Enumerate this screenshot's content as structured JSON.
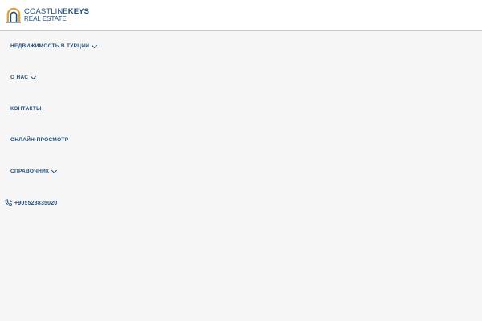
{
  "logo": {
    "word1": "COASTLINE",
    "word2": "KEYS",
    "line2": "REAL ESTATE"
  },
  "menu": {
    "items": [
      {
        "label": "НЕДВИЖИМОСТЬ В ТУРЦИИ",
        "has_dropdown": true
      },
      {
        "label": "О НАС",
        "has_dropdown": true
      },
      {
        "label": "КОНТАКТЫ",
        "has_dropdown": false
      },
      {
        "label": "ОНЛАЙН-ПРОСМОТР",
        "has_dropdown": false
      },
      {
        "label": "СПРАВОЧНИК",
        "has_dropdown": true
      }
    ]
  },
  "phone": {
    "number": "+905528835020",
    "icon": "phone-icon"
  },
  "colors": {
    "brand": "#1f4e79",
    "accent": "#d9a441",
    "background": "#f6f6f6"
  }
}
